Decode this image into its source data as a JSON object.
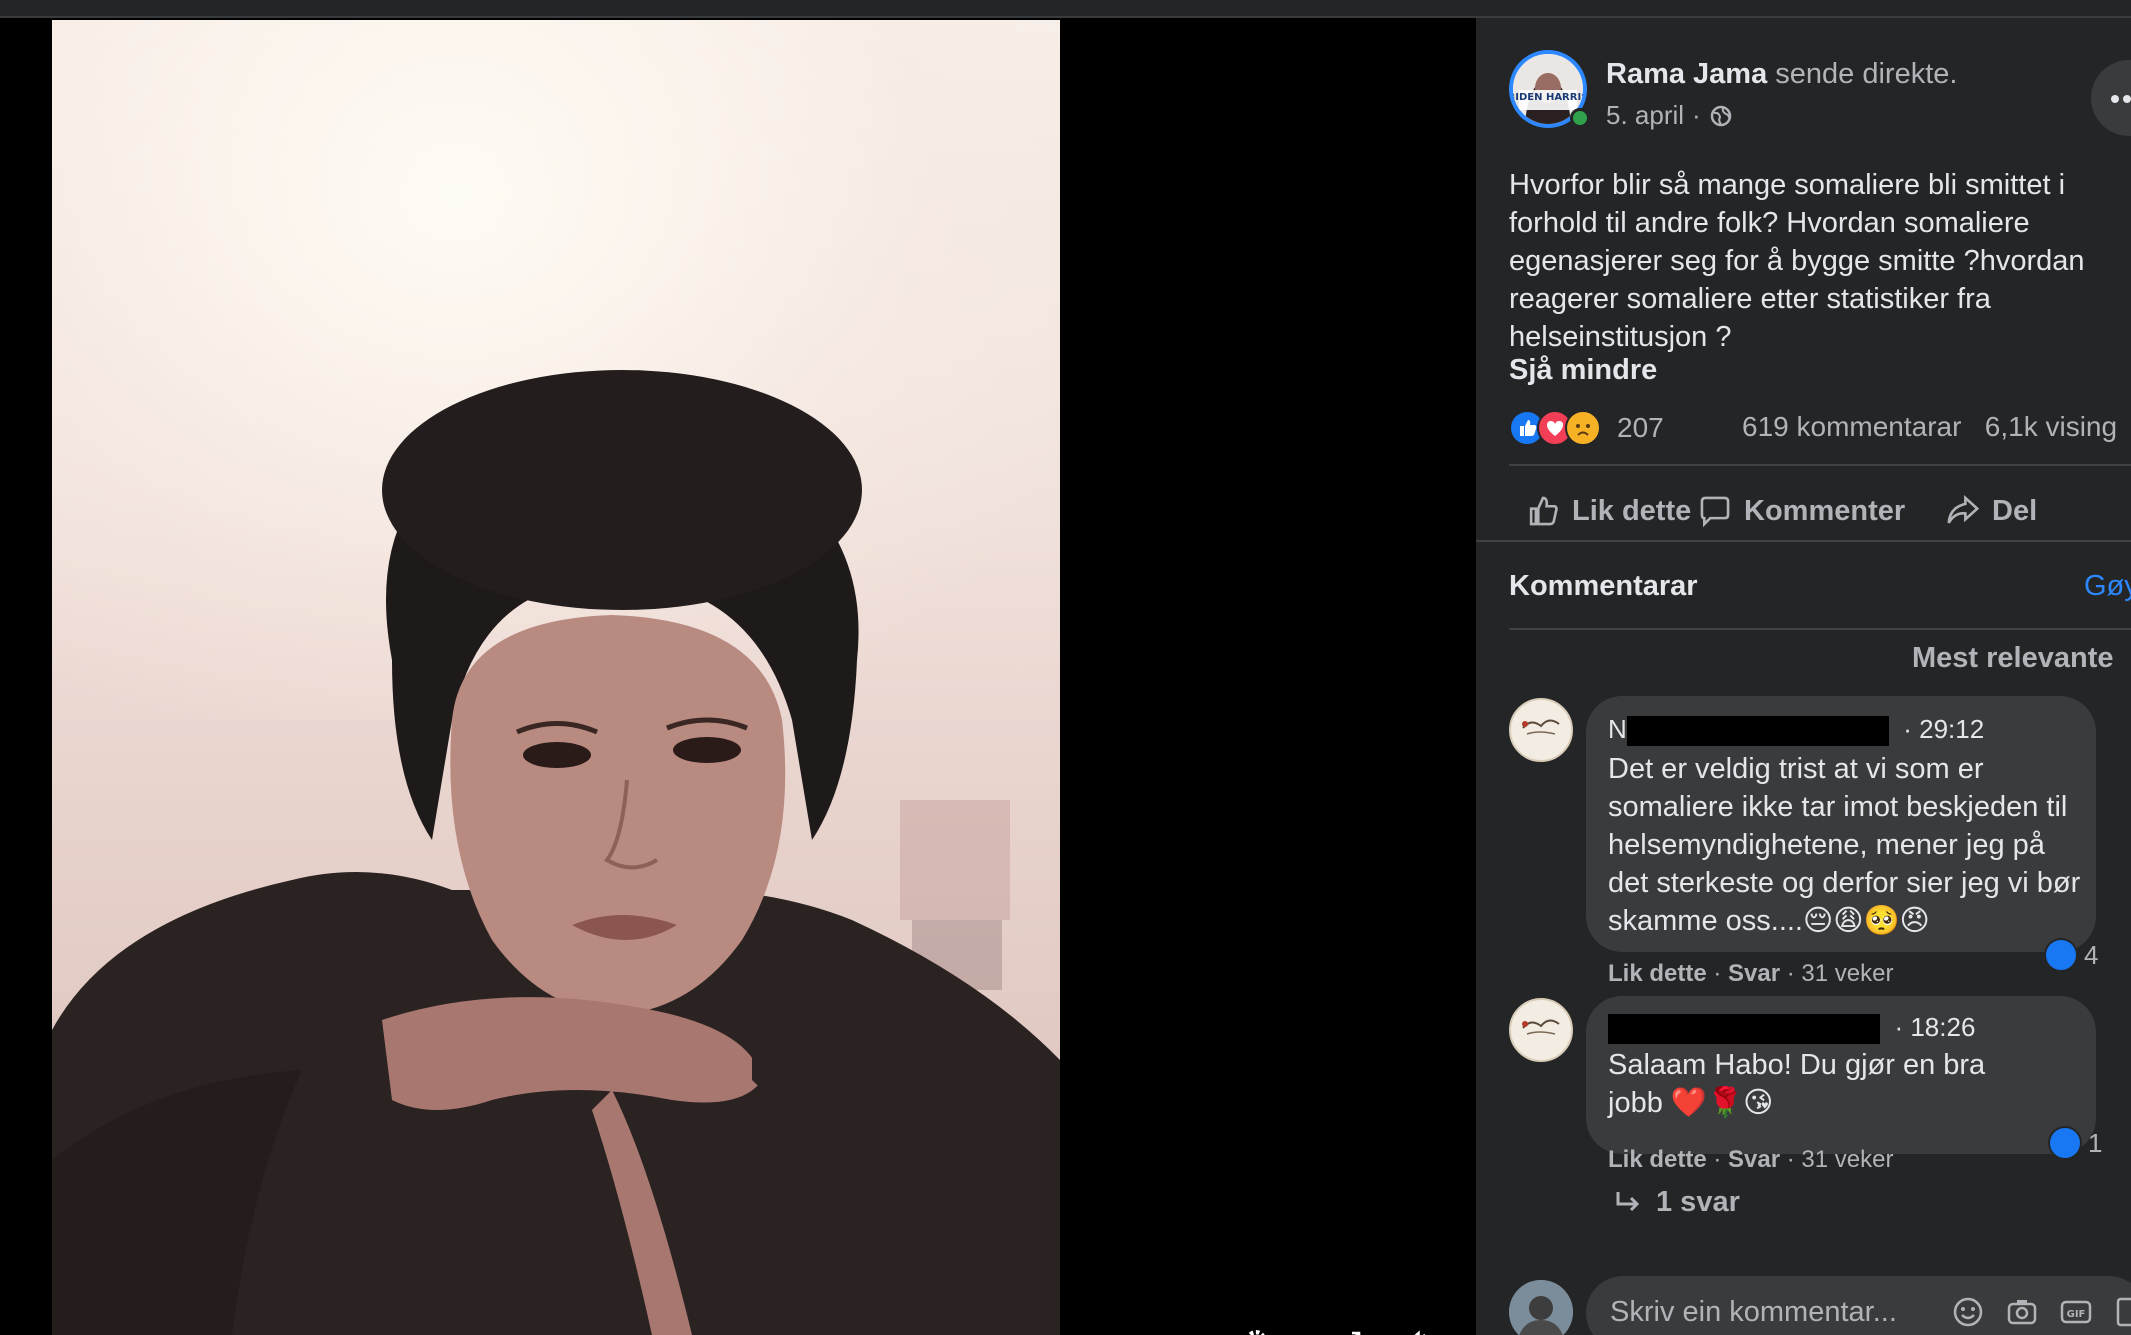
{
  "post": {
    "author": "Rama Jama",
    "action": "sende direkte.",
    "date": "5. april",
    "separator": "·",
    "audience_icon": "globe-icon",
    "text": "Hvorfor blir så mange somaliere bli smittet i forhold til andre folk? Hvordan somaliere egenasjerer seg for å bygge smitte ?hvordan reagerer somaliere etter statistiker fra helseinstitusjon ?",
    "see_less": "Sjå mindre",
    "reaction_count": "207",
    "comment_count": "619 kommentarar",
    "view_count": "6,1k vising",
    "reaction_icons": [
      "like-reaction-icon",
      "love-reaction-icon",
      "sad-reaction-icon"
    ],
    "avatar_badge": "BIDEN HARRIS"
  },
  "actions": {
    "like": "Lik dette",
    "comment": "Kommenter",
    "share": "Del"
  },
  "comments_section": {
    "title": "Kommentarar",
    "link": "Gøy",
    "sort": "Mest relevante"
  },
  "comments": [
    {
      "name_visible": "N",
      "time": "29:12",
      "body": "Det er veldig trist at vi som er somaliere ikke tar imot beskjeden til helsemyndighetene, mener jeg på det sterkeste og derfor sier jeg vi bør skamme oss....😔😩🥺😠",
      "like": "Lik dette",
      "reply": "Svar",
      "age": "31 veker",
      "likes": "4"
    },
    {
      "name_visible": "",
      "time": "18:26",
      "body": "Salaam Habo! Du gjør en bra jobb ❤️🌹😘",
      "like": "Lik dette",
      "reply": "Svar",
      "age": "31 veker",
      "likes": "1"
    }
  ],
  "replies_link": "1 svar",
  "composer": {
    "placeholder": "Skriv ein kommentar..."
  },
  "colors": {
    "sidebar_bg": "#242526",
    "bubble_bg": "#3a3b3c",
    "text_primary": "#e4e6eb",
    "text_secondary": "#b0b3b8",
    "accent": "#2d88ff",
    "like_blue": "#1877f2"
  }
}
